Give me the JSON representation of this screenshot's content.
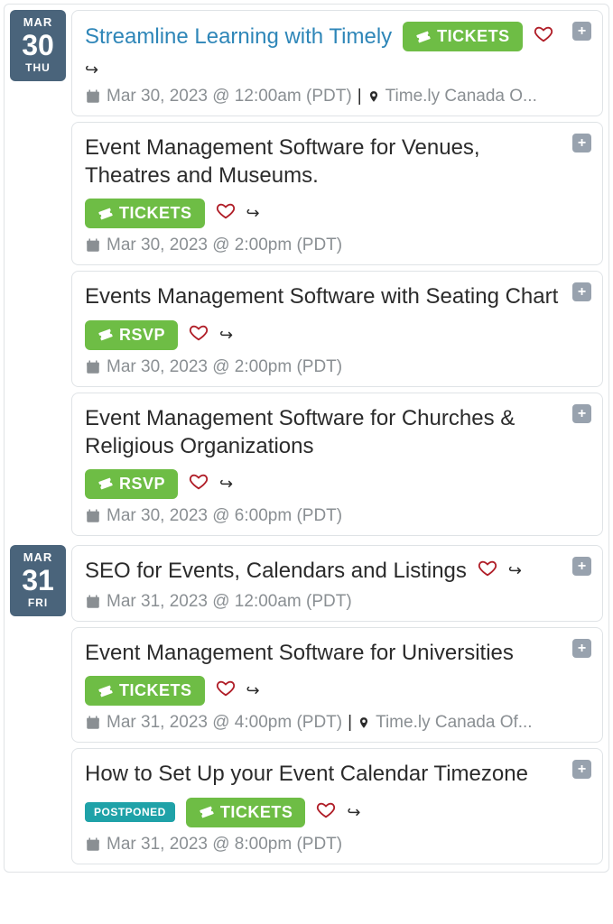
{
  "days": [
    {
      "month": "MAR",
      "daynum": "30",
      "dow": "THU",
      "events": [
        {
          "title": "Streamline Learning with Timely",
          "link": true,
          "badge": "TICKETS",
          "heart": true,
          "share": true,
          "datetime": "Mar 30, 2023 @ 12:00am (PDT)",
          "location": "Time.ly Canada O..."
        },
        {
          "title": "Event Management Software for Venues, Theatres and Museums.",
          "badge": "TICKETS",
          "heart": true,
          "share": true,
          "datetime": "Mar 30, 2023 @ 2:00pm (PDT)"
        },
        {
          "title": "Events Management Software with Seating Chart",
          "badge": "RSVP",
          "heart": true,
          "share": true,
          "datetime": "Mar 30, 2023 @ 2:00pm (PDT)"
        },
        {
          "title": "Event Management Software for Churches & Religious Organizations",
          "badge": "RSVP",
          "heart": true,
          "share": true,
          "datetime": "Mar 30, 2023 @ 6:00pm (PDT)"
        }
      ]
    },
    {
      "month": "MAR",
      "daynum": "31",
      "dow": "FRI",
      "events": [
        {
          "title": "SEO for Events, Calendars and Listings",
          "heart": true,
          "share": true,
          "datetime": "Mar 31, 2023 @ 12:00am (PDT)"
        },
        {
          "title": "Event Management Software for Universities",
          "badge": "TICKETS",
          "heart": true,
          "share": true,
          "datetime": "Mar 31, 2023 @ 4:00pm (PDT)",
          "location": "Time.ly Canada Of..."
        },
        {
          "title": "How to Set Up your Event Calendar Timezone",
          "status": "POSTPONED",
          "badge": "TICKETS",
          "heart": true,
          "share": true,
          "datetime": "Mar 31, 2023 @ 8:00pm (PDT)"
        }
      ]
    }
  ]
}
